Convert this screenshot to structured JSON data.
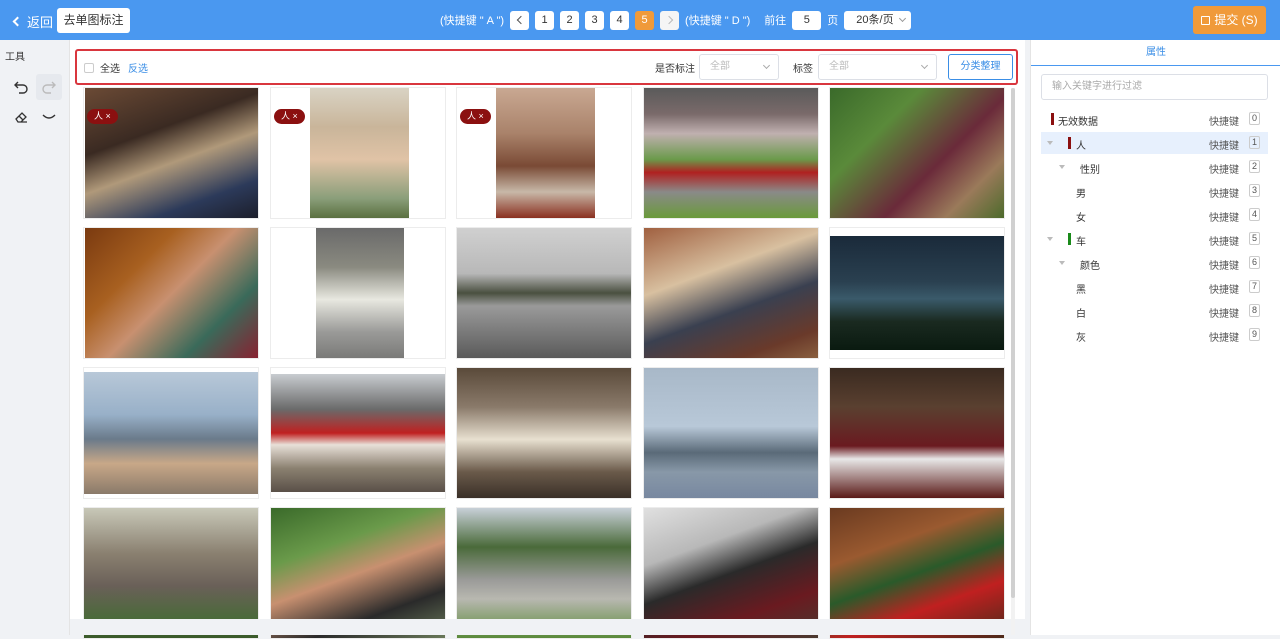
{
  "topbar": {
    "back_label": "返回",
    "single_label_button": "去单图标注",
    "prev_hint": "(快捷键 \" A \")",
    "next_hint": "(快捷键 \" D \")",
    "pages": [
      "1",
      "2",
      "3",
      "4",
      "5"
    ],
    "current_page": "5",
    "goto_label": "前往",
    "goto_value": "5",
    "page_unit": "页",
    "page_size": "20条/页",
    "submit_label": "提交 (S)"
  },
  "tools": {
    "title": "工具",
    "items": [
      "undo-icon",
      "redo-icon",
      "eraser-icon",
      "curve-icon"
    ]
  },
  "filter": {
    "select_all": "全选",
    "invert": "反选",
    "annotated_label": "是否标注",
    "annotated_value": "全部",
    "tag_label": "标签",
    "tag_value": "全部",
    "classify_button": "分类整理"
  },
  "images": [
    {
      "desc": "girl-kitchen",
      "tag": "人 ×"
    },
    {
      "desc": "girl-hat",
      "tag": "人 ×"
    },
    {
      "desc": "food-plate",
      "tag": "人 ×"
    },
    {
      "desc": "motorcycle-track",
      "tag": ""
    },
    {
      "desc": "woman-cat",
      "tag": ""
    },
    {
      "desc": "woman-laughing",
      "tag": ""
    },
    {
      "desc": "white-horse",
      "tag": ""
    },
    {
      "desc": "motorcycles-road",
      "tag": ""
    },
    {
      "desc": "living-room",
      "tag": ""
    },
    {
      "desc": "sunset-field",
      "tag": ""
    },
    {
      "desc": "cowboy-horse",
      "tag": ""
    },
    {
      "desc": "train-station",
      "tag": ""
    },
    {
      "desc": "sheep-cage",
      "tag": ""
    },
    {
      "desc": "warships",
      "tag": ""
    },
    {
      "desc": "dining-table",
      "tag": ""
    },
    {
      "desc": "bicycle-tree",
      "tag": ""
    },
    {
      "desc": "kids-motorcycle",
      "tag": ""
    },
    {
      "desc": "street-dog",
      "tag": ""
    },
    {
      "desc": "steam-train",
      "tag": ""
    },
    {
      "desc": "christmas-tree",
      "tag": ""
    }
  ],
  "right_panel": {
    "tab": "属性",
    "filter_placeholder": "输入关键字进行过滤",
    "tree": [
      {
        "label": "无效数据",
        "hotkey_label": "快捷键",
        "hotkey": "0",
        "color": "#8b1010"
      },
      {
        "label": "人",
        "hotkey_label": "快捷键",
        "hotkey": "1",
        "color": "#8b1010"
      },
      {
        "label": "性别",
        "hotkey_label": "快捷键",
        "hotkey": "2",
        "color": ""
      },
      {
        "label": "男",
        "hotkey_label": "快捷键",
        "hotkey": "3",
        "color": ""
      },
      {
        "label": "女",
        "hotkey_label": "快捷键",
        "hotkey": "4",
        "color": ""
      },
      {
        "label": "车",
        "hotkey_label": "快捷键",
        "hotkey": "5",
        "color": "#1a8a1a"
      },
      {
        "label": "颜色",
        "hotkey_label": "快捷键",
        "hotkey": "6",
        "color": ""
      },
      {
        "label": "黑",
        "hotkey_label": "快捷键",
        "hotkey": "7",
        "color": ""
      },
      {
        "label": "白",
        "hotkey_label": "快捷键",
        "hotkey": "8",
        "color": ""
      },
      {
        "label": "灰",
        "hotkey_label": "快捷键",
        "hotkey": "9",
        "color": ""
      }
    ]
  },
  "colors": {
    "topbar": "#4a98f0",
    "accent": "#3a8ee6",
    "submit": "#f09a3a",
    "tag": "#8b1010"
  }
}
